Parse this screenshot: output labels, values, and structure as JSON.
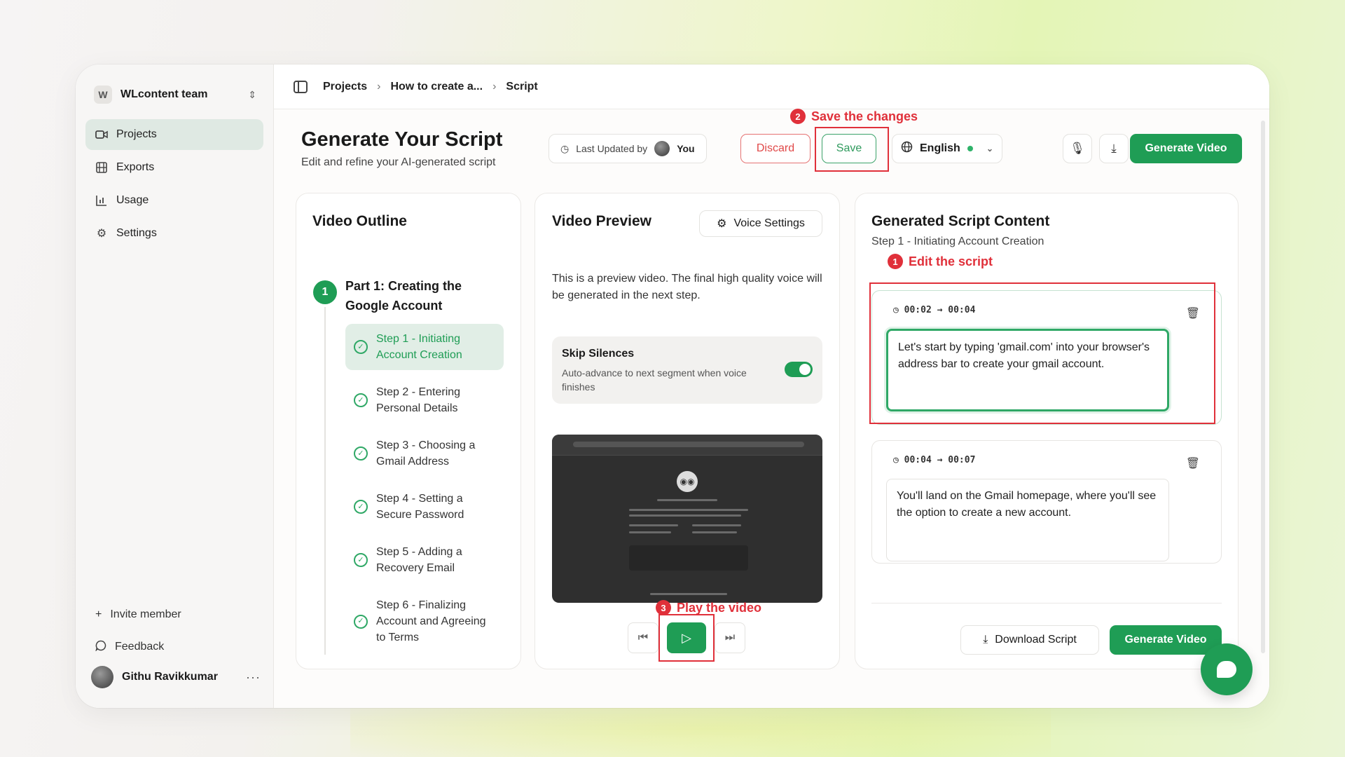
{
  "sidebar": {
    "team": {
      "initial": "W",
      "name": "WLcontent team"
    },
    "nav": [
      {
        "label": "Projects",
        "icon": "video-icon",
        "active": true
      },
      {
        "label": "Exports",
        "icon": "film-icon",
        "active": false
      },
      {
        "label": "Usage",
        "icon": "bar-chart-icon",
        "active": false
      },
      {
        "label": "Settings",
        "icon": "gear-icon",
        "active": false
      }
    ],
    "invite": "Invite member",
    "feedback": "Feedback",
    "user": {
      "name": "Githu Ravikkumar",
      "more": "···"
    }
  },
  "breadcrumb": {
    "items": [
      "Projects",
      "How to create a...",
      "Script"
    ]
  },
  "header": {
    "title": "Generate Your Script",
    "subtitle": "Edit and refine your AI-generated script",
    "last_updated_label": "Last Updated by",
    "last_updated_user": "You",
    "discard": "Discard",
    "save": "Save",
    "language": "English",
    "generate_video": "Generate Video"
  },
  "annotations": {
    "save": {
      "num": "2",
      "text": "Save the changes"
    },
    "edit": {
      "num": "1",
      "text": "Edit the script"
    },
    "play": {
      "num": "3",
      "text": "Play the video"
    }
  },
  "outline": {
    "title": "Video Outline",
    "part_number": "1",
    "part_title": "Part 1: Creating the Google Account",
    "steps": [
      {
        "label": "Step 1 - Initiating Account Creation",
        "active": true
      },
      {
        "label": "Step 2 - Entering Personal Details",
        "active": false
      },
      {
        "label": "Step 3 - Choosing a Gmail Address",
        "active": false
      },
      {
        "label": "Step 4 - Setting a Secure Password",
        "active": false
      },
      {
        "label": "Step 5 - Adding a Recovery Email",
        "active": false
      },
      {
        "label": "Step 6 - Finalizing Account and Agreeing to Terms",
        "active": false
      }
    ]
  },
  "preview": {
    "title": "Video Preview",
    "voice_settings": "Voice Settings",
    "description": "This is a preview video. The final high quality voice will be generated in the next step.",
    "skip_silences": {
      "title": "Skip Silences",
      "description": "Auto-advance to next segment when voice finishes",
      "enabled": true
    }
  },
  "script": {
    "title": "Generated Script Content",
    "subtitle": "Step 1 - Initiating Account Creation",
    "segments": [
      {
        "time": "00:02 → 00:04",
        "text": "Let's start by typing 'gmail.com' into your browser's address bar to create your gmail account."
      },
      {
        "time": "00:04 → 00:07",
        "text": "You'll land on the Gmail homepage, where you'll see the option to create a new account."
      }
    ],
    "download": "Download Script",
    "generate": "Generate Video"
  },
  "colors": {
    "accent": "#1f9d55",
    "annotation": "#e0303a",
    "discard": "#e04848"
  }
}
